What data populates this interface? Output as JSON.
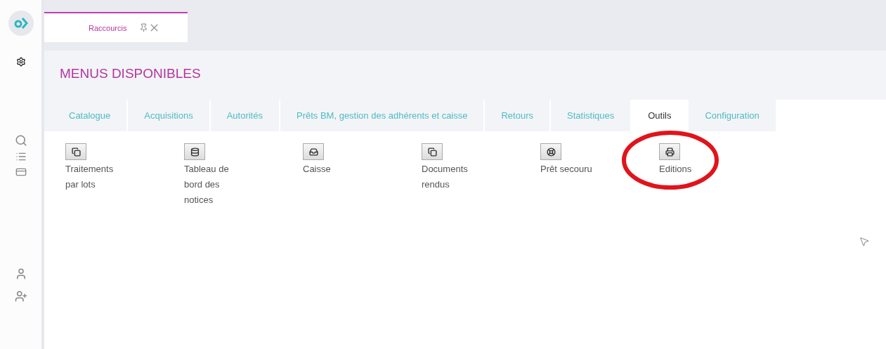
{
  "open_tabs": [
    {
      "label": "Raccourcis",
      "selected": true
    }
  ],
  "panel": {
    "title": "MENUS DISPONIBLES"
  },
  "menu_tabs": [
    {
      "label": "Catalogue",
      "selected": false
    },
    {
      "label": "Acquisitions",
      "selected": false
    },
    {
      "label": "Autorités",
      "selected": false
    },
    {
      "label": "Prêts BM, gestion des adhérents et caisse",
      "selected": false
    },
    {
      "label": "Retours",
      "selected": false
    },
    {
      "label": "Statistiques",
      "selected": false
    },
    {
      "label": "Outils",
      "selected": true
    },
    {
      "label": "Configuration",
      "selected": false
    }
  ],
  "shortcuts": [
    {
      "kind": "copy",
      "label": "Traitements par lots",
      "highlighted": false
    },
    {
      "kind": "database",
      "label": "Tableau de bord des notices",
      "highlighted": false
    },
    {
      "kind": "inbox",
      "label": "Caisse",
      "highlighted": false
    },
    {
      "kind": "copy",
      "label": "Documents rendus",
      "highlighted": false
    },
    {
      "kind": "lifebuoy",
      "label": "Prêt secouru",
      "highlighted": false
    },
    {
      "kind": "printer",
      "label": "Editions",
      "highlighted": true
    }
  ]
}
